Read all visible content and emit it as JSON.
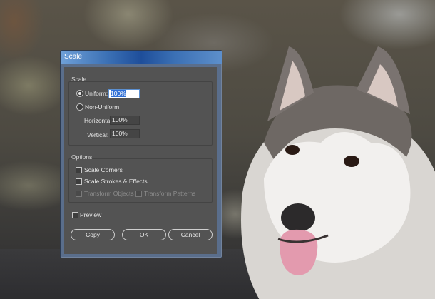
{
  "dialog": {
    "title": "Scale",
    "scale_group": {
      "label": "Scale",
      "uniform": {
        "label": "Uniform:",
        "value": "100%",
        "selected": true
      },
      "non_uniform": {
        "label": "Non-Uniform",
        "selected": false
      },
      "horizontal": {
        "label": "Horizontal:",
        "value": "100%"
      },
      "vertical": {
        "label": "Vertical:",
        "value": "100%"
      }
    },
    "options_group": {
      "label": "Options",
      "scale_corners": {
        "label": "Scale Corners",
        "checked": false
      },
      "scale_strokes": {
        "label": "Scale Strokes & Effects",
        "checked": false
      },
      "transform_objects": {
        "label": "Transform Objects",
        "checked": true,
        "enabled": false
      },
      "transform_patterns": {
        "label": "Transform Patterns",
        "checked": false,
        "enabled": false
      }
    },
    "preview": {
      "label": "Preview",
      "checked": false
    },
    "buttons": {
      "copy": "Copy",
      "ok": "OK",
      "cancel": "Cancel"
    }
  },
  "colors": {
    "title_bar": "#2b62b0",
    "panel": "#535353",
    "selection": "#2f6fd6"
  }
}
